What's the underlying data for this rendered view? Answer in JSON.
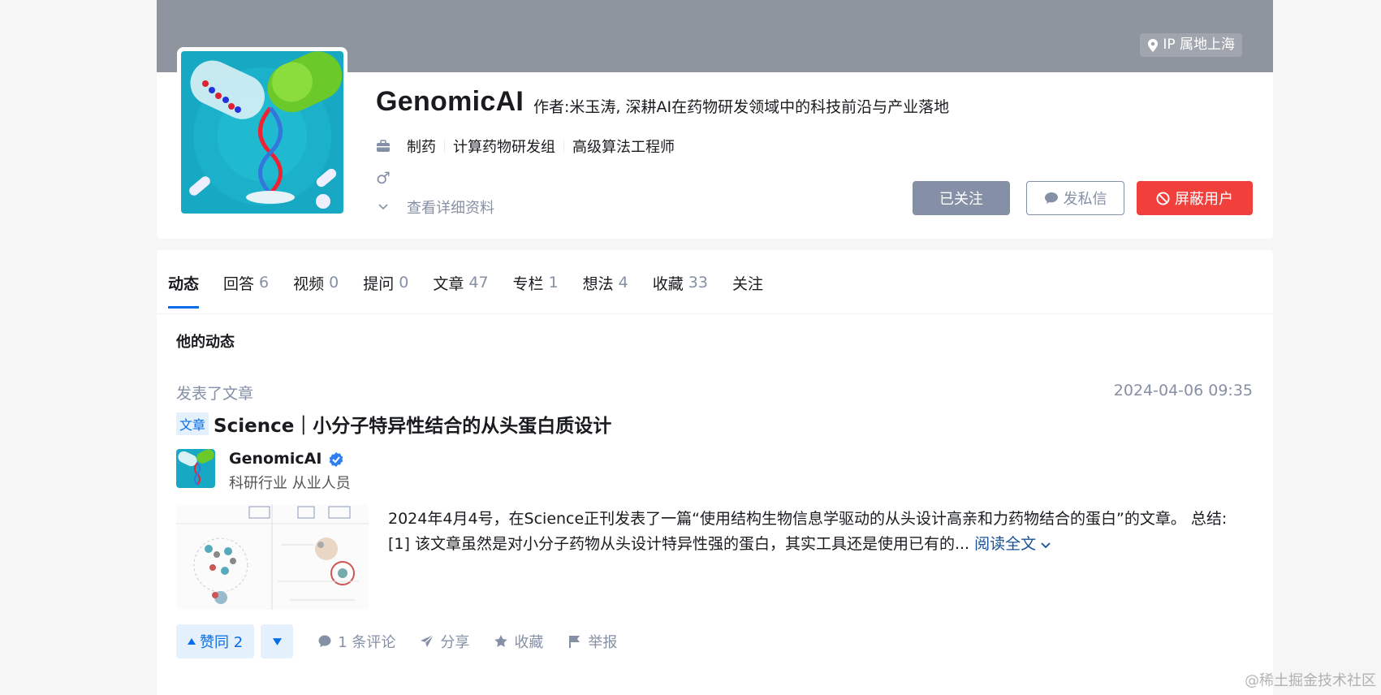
{
  "profile": {
    "ip_location": "IP 属地上海",
    "name": "GenomicAI",
    "headline": "作者:米玉涛, 深耕AI在药物研发领域中的科技前沿与产业落地",
    "business": [
      "制药",
      "计算药物研发组",
      "高级算法工程师"
    ],
    "gender_symbol": "♂",
    "detail_link": "查看详细资料",
    "buttons": {
      "followed": "已关注",
      "message": "发私信",
      "block": "屏蔽用户"
    }
  },
  "tabs": [
    {
      "label": "动态",
      "count": ""
    },
    {
      "label": "回答",
      "count": "6"
    },
    {
      "label": "视频",
      "count": "0"
    },
    {
      "label": "提问",
      "count": "0"
    },
    {
      "label": "文章",
      "count": "47"
    },
    {
      "label": "专栏",
      "count": "1"
    },
    {
      "label": "想法",
      "count": "4"
    },
    {
      "label": "收藏",
      "count": "33"
    },
    {
      "label": "关注",
      "count": ""
    }
  ],
  "feed": {
    "section_title": "他的动态",
    "item": {
      "action": "发表了文章",
      "time": "2024-04-06 09:35",
      "tag": "文章",
      "title": "Science｜小分子特异性结合的从头蛋白质设计",
      "author_name": "GenomicAI",
      "author_desc": "科研行业 从业人员",
      "excerpt": "2024年4月4号，在Science正刊发表了一篇“使用结构生物信息学驱动的从头设计高亲和力药物结合的蛋白”的文章。 总结: [1] 该文章虽然是对小分子药物从头设计特异性强的蛋白，其实工具还是使用已有的...",
      "read_more": "阅读全文",
      "vote_up": "赞同 2",
      "comments": "1 条评论",
      "share": "分享",
      "favorite": "收藏",
      "report": "举报"
    }
  },
  "watermark": "@稀土掘金技术社区",
  "colors": {
    "brand_blue": "#056de8",
    "danger": "#f1403c",
    "muted": "#8590a6",
    "cover": "#8f959f"
  }
}
